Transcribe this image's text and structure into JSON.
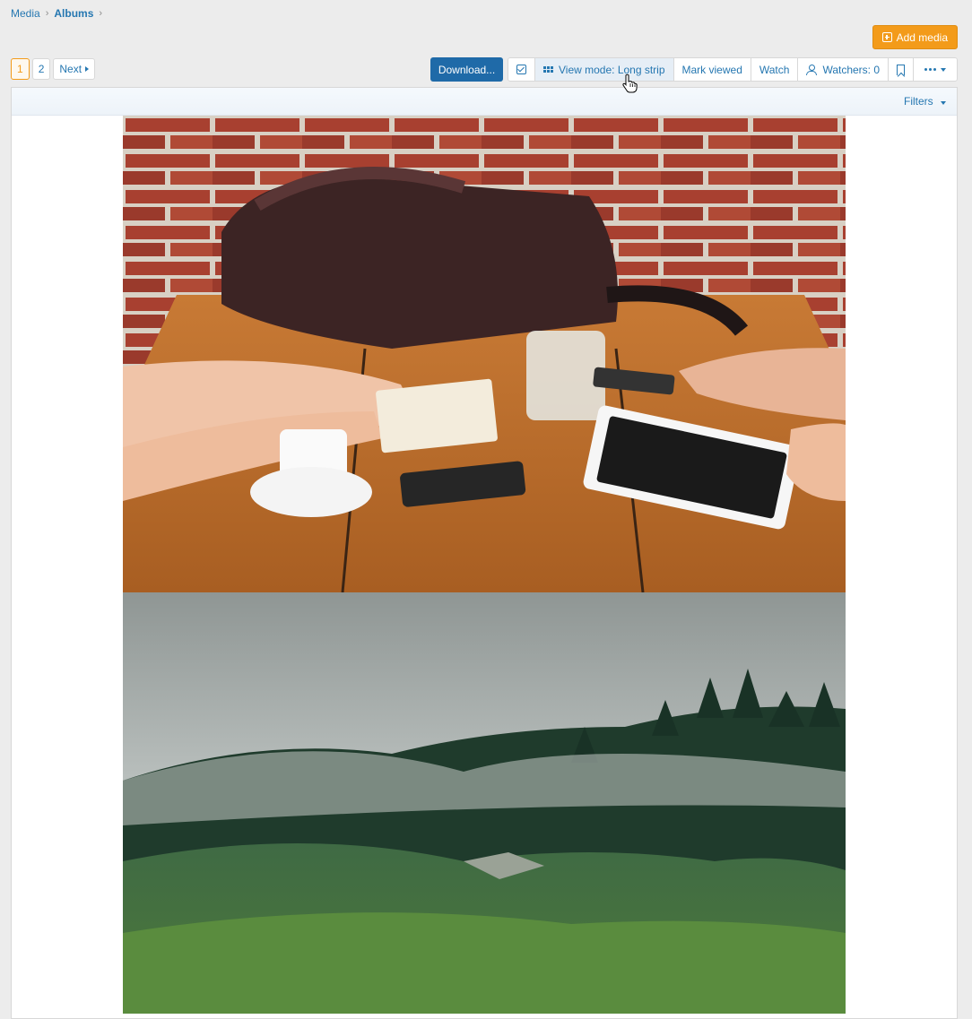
{
  "breadcrumb": {
    "items": [
      "Media",
      "Albums"
    ]
  },
  "header": {
    "add_media_label": "Add media"
  },
  "pagination": {
    "pages": [
      "1",
      "2"
    ],
    "current": "1",
    "next_label": "Next"
  },
  "toolbar": {
    "download_label": "Download...",
    "view_mode_label": "View mode: Long strip",
    "mark_viewed_label": "Mark viewed",
    "watch_label": "Watch",
    "watchers_label": "Watchers: 0"
  },
  "filters": {
    "label": "Filters"
  },
  "colors": {
    "accent": "#f39b1a",
    "primary": "#1f6aa8",
    "link": "#2577b1"
  },
  "icons": [
    "plus-square-icon",
    "checkbox-icon",
    "grid-icon",
    "user-icon",
    "bookmark-icon",
    "more-dots-icon",
    "chevron-right-icon",
    "caret-down-icon",
    "pointer-cursor-icon"
  ]
}
